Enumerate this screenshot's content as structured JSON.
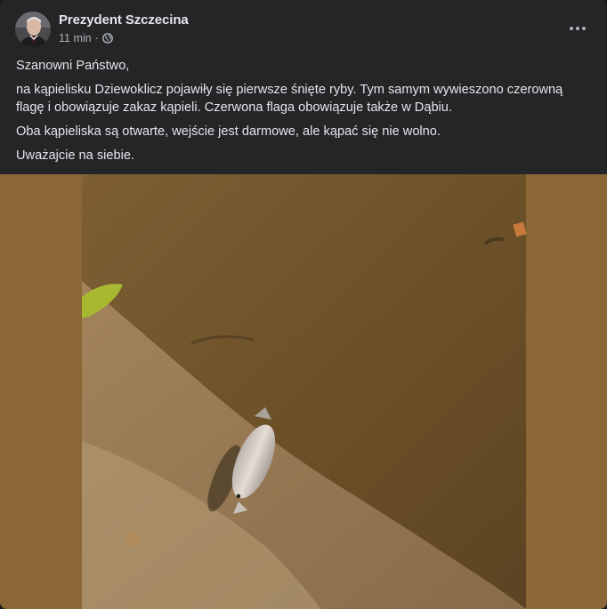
{
  "post": {
    "author": "Prezydent Szczecina",
    "time": "11 min",
    "privacy_separator": "·",
    "paragraphs": [
      "Szanowni Państwo,",
      "na kąpielisku Dziewoklicz pojawiły się pierwsze śnięte ryby. Tym samym wywieszono czerowną flagę i obowiązuje zakaz kąpieli. Czerwona flaga obowiązuje także w Dąbiu.",
      "Oba kąpieliska są otwarte, wejście jest darmowe, ale kąpać się nie wolno.",
      "Uważajcie na siebie."
    ]
  },
  "icons": {
    "privacy": "globe-icon",
    "menu": "more-options-icon"
  },
  "colors": {
    "card_bg": "#242526",
    "text_primary": "#e4e6eb",
    "text_secondary": "#b0b3b8",
    "photo_frame": "#8a6534"
  }
}
